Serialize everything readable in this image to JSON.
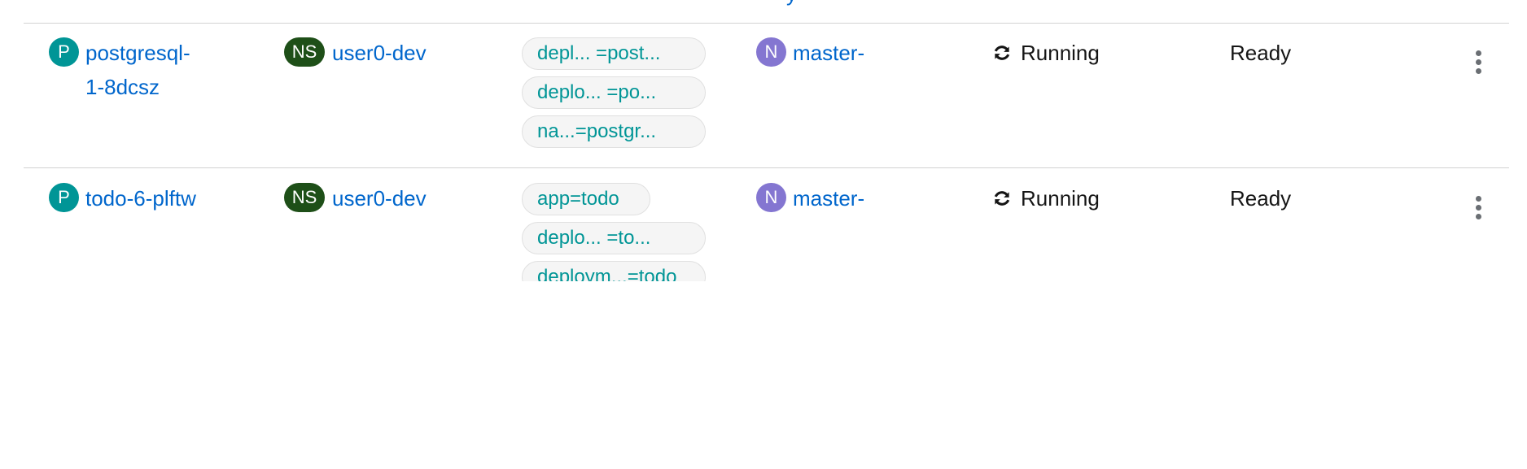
{
  "header": {
    "partial_link_text": "y"
  },
  "rows": [
    {
      "pod_badge": "P",
      "pod_name": "postgresql-\n1-8dcsz",
      "namespace_badge": "NS",
      "namespace": "user0-dev",
      "labels": [
        "depl... =post...",
        "deplo... =po...",
        "na...=postgr..."
      ],
      "node_badge": "N",
      "node": "master-",
      "status": "Running",
      "readiness": "Ready"
    },
    {
      "pod_badge": "P",
      "pod_name": "todo-6-plftw",
      "namespace_badge": "NS",
      "namespace": "user0-dev",
      "labels": [
        "app=todo",
        "deplo... =to...",
        "deploym...=todo"
      ],
      "node_badge": "N",
      "node": "master-",
      "status": "Running",
      "readiness": "Ready"
    }
  ],
  "colors": {
    "link": "#0066cc",
    "pod_badge": "#009596",
    "namespace_badge": "#1e4f18",
    "node_badge": "#8476d1",
    "label_text": "#009596"
  },
  "icons": {
    "status": "sync-icon",
    "actions": "kebab-icon"
  }
}
